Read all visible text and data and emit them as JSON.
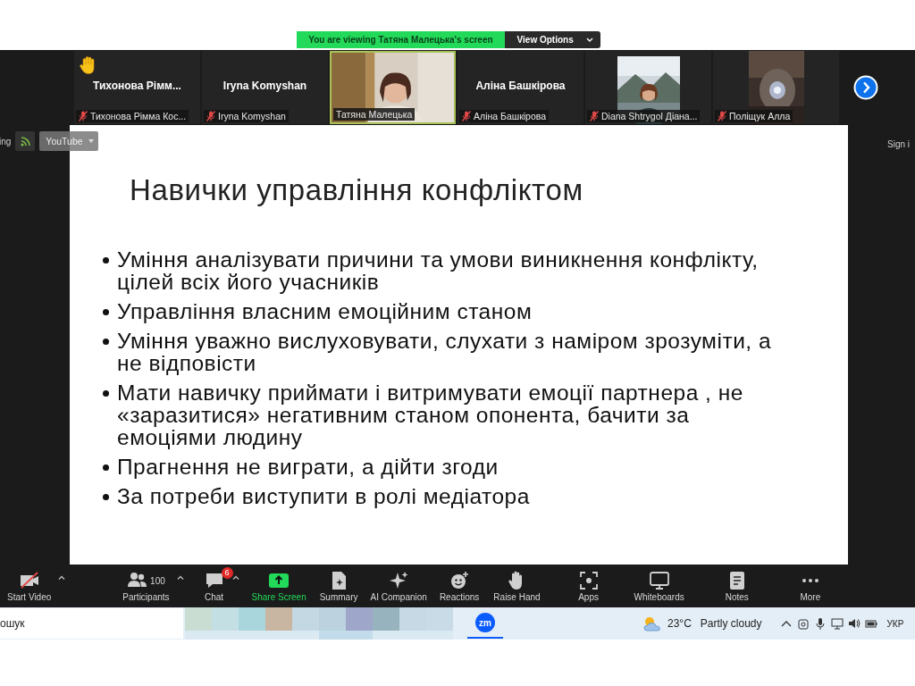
{
  "banner": {
    "text": "You are viewing Татяна Малецька's screen",
    "button": "View Options"
  },
  "participants": [
    {
      "kind": "name",
      "name": "Тихонова  Рімм...",
      "label": "Тихонова Рімма Кос...",
      "muted": true,
      "raised_hand": true,
      "active_speaker": false
    },
    {
      "kind": "name",
      "name": "Iryna Komyshan",
      "label": "Iryna Komyshan",
      "muted": true,
      "raised_hand": false,
      "active_speaker": false
    },
    {
      "kind": "video",
      "label": "Татяна Малецька",
      "muted": false,
      "raised_hand": false,
      "active_speaker": true
    },
    {
      "kind": "name",
      "name": "Аліна Башкірова",
      "label": "Аліна Башкірова",
      "muted": true,
      "raised_hand": false,
      "active_speaker": false
    },
    {
      "kind": "video",
      "label": "Diana Shtrygol  Діана...",
      "muted": true,
      "raised_hand": false,
      "active_speaker": false
    },
    {
      "kind": "video",
      "label": "Поліщук Алла",
      "muted": true,
      "raised_hand": false,
      "active_speaker": false
    }
  ],
  "overlay": {
    "left_text": "ing",
    "dropdown": "YouTube",
    "right_text": "Sign i"
  },
  "slide": {
    "title": "Навички управління конфліктом",
    "bullets": [
      {
        "lines": [
          "Уміння аналізувати причини та умови виникнення конфлікту,",
          "цілей всіх його учасників"
        ]
      },
      {
        "lines": [
          "Управління власним емоційним станом"
        ]
      },
      {
        "lines": [
          "Уміння  уважно вислуховувати, слухати з наміром зрозуміти, а",
          "не відповісти"
        ]
      },
      {
        "lines": [
          "Мати навичку приймати і витримувати емоції партнера , не",
          "«заразитися» негативним станом опонента, бачити за",
          "емоціями людину"
        ]
      },
      {
        "lines": [
          "Прагнення не виграти, а дійти згоди"
        ]
      },
      {
        "lines": [
          "За потреби виступити в ролі медіатора"
        ]
      }
    ]
  },
  "toolbar": [
    {
      "kind": "video",
      "label": "Start Video",
      "caret": true
    },
    {
      "kind": "participants",
      "label": "Participants",
      "count": "100",
      "caret": true
    },
    {
      "kind": "chat",
      "label": "Chat",
      "badge": "6",
      "caret": true
    },
    {
      "kind": "share",
      "label": "Share Screen",
      "caret": false
    },
    {
      "kind": "summary",
      "label": "Summary",
      "caret": false
    },
    {
      "kind": "ai",
      "label": "AI Companion",
      "caret": false
    },
    {
      "kind": "reactions",
      "label": "Reactions",
      "caret": false
    },
    {
      "kind": "hand",
      "label": "Raise Hand",
      "caret": false
    },
    {
      "kind": "apps",
      "label": "Apps",
      "caret": false
    },
    {
      "kind": "whiteboards",
      "label": "Whiteboards",
      "caret": false
    },
    {
      "kind": "notes",
      "label": "Notes",
      "caret": false
    },
    {
      "kind": "more",
      "label": "More",
      "caret": false
    }
  ],
  "taskbar": {
    "search": "ошук",
    "app_logo": "zm",
    "weather": {
      "temp": "23°C",
      "condition": "Partly cloudy"
    },
    "language": "УКР"
  }
}
